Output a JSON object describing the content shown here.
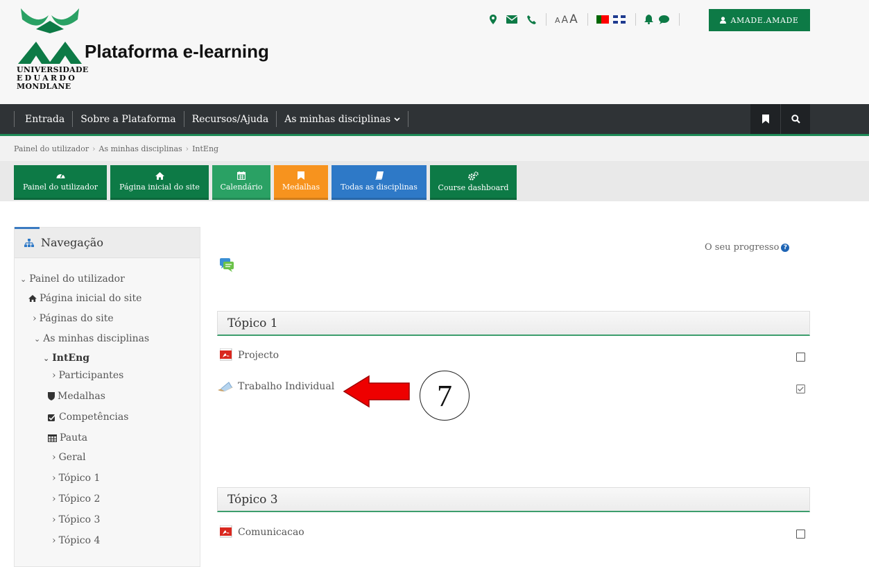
{
  "header": {
    "site_title": "Plataforma e-learning",
    "logo_lines": [
      "UNIVERSIDADE",
      "EDUARDO",
      "MONDLANE"
    ],
    "font_size_labels": [
      "A",
      "A",
      "A"
    ],
    "user_button_label": "AMADE.AMADE",
    "icons": [
      "map-marker-icon",
      "envelope-icon",
      "phone-icon",
      "flag-pt-icon",
      "flag-gb-icon",
      "bell-icon",
      "chat-bubble-icon",
      "user-icon"
    ],
    "brand_color": "#0d7a46"
  },
  "navbar": {
    "items": [
      {
        "label": "Entrada"
      },
      {
        "label": "Sobre a Plataforma"
      },
      {
        "label": "Recursos/Ajuda"
      },
      {
        "label": "As minhas disciplinas"
      }
    ],
    "right_icons": [
      "bookmark-icon",
      "search-icon"
    ]
  },
  "breadcrumb": [
    "Painel do utilizador",
    "As minhas disciplinas",
    "IntEng"
  ],
  "quick_buttons": [
    {
      "label": "Painel do utilizador",
      "icon": "dashboard-icon",
      "color": "#0d7a46"
    },
    {
      "label": "Página inicial do site",
      "icon": "home-icon",
      "color": "#0d7a46"
    },
    {
      "label": "Calendário",
      "icon": "calendar-icon",
      "color": "#2aa164"
    },
    {
      "label": "Medalhas",
      "icon": "bookmark-icon",
      "color": "#f7931e"
    },
    {
      "label": "Todas as disciplinas",
      "icon": "book-icon",
      "color": "#2e79c7"
    },
    {
      "label": "Course dashboard",
      "icon": "cogs-icon",
      "color": "#0d7a46"
    }
  ],
  "sidebar": {
    "title": "Navegação",
    "items": [
      {
        "label": "Painel do utilizador",
        "prefix": "⌄"
      },
      {
        "label": "Página inicial do site",
        "prefix": "home"
      },
      {
        "label": "Páginas do site",
        "prefix": "›"
      },
      {
        "label": "As minhas disciplinas",
        "prefix": "⌄"
      },
      {
        "label": "IntEng",
        "prefix": "⌄"
      },
      {
        "label": "Participantes",
        "prefix": "›"
      },
      {
        "label": "Medalhas",
        "prefix": "shield"
      },
      {
        "label": "Competências",
        "prefix": "check"
      },
      {
        "label": "Pauta",
        "prefix": "table"
      },
      {
        "label": "Geral",
        "prefix": "›"
      },
      {
        "label": "Tópico 1",
        "prefix": "›"
      },
      {
        "label": "Tópico 2",
        "prefix": "›"
      },
      {
        "label": "Tópico 3",
        "prefix": "›"
      },
      {
        "label": "Tópico 4",
        "prefix": "›"
      }
    ]
  },
  "main": {
    "progress_label": "O seu progresso",
    "sections": [
      {
        "title": "Tópico 1",
        "activities": [
          {
            "label": "Projecto",
            "icon": "pdf-icon",
            "completed": false
          },
          {
            "label": "Trabalho Individual",
            "icon": "assignment-icon",
            "completed": true
          }
        ]
      },
      {
        "title": "Tópico 3",
        "activities": [
          {
            "label": "Comunicacao",
            "icon": "pdf-icon",
            "completed": false
          }
        ]
      }
    ],
    "annotation_number": "7"
  }
}
